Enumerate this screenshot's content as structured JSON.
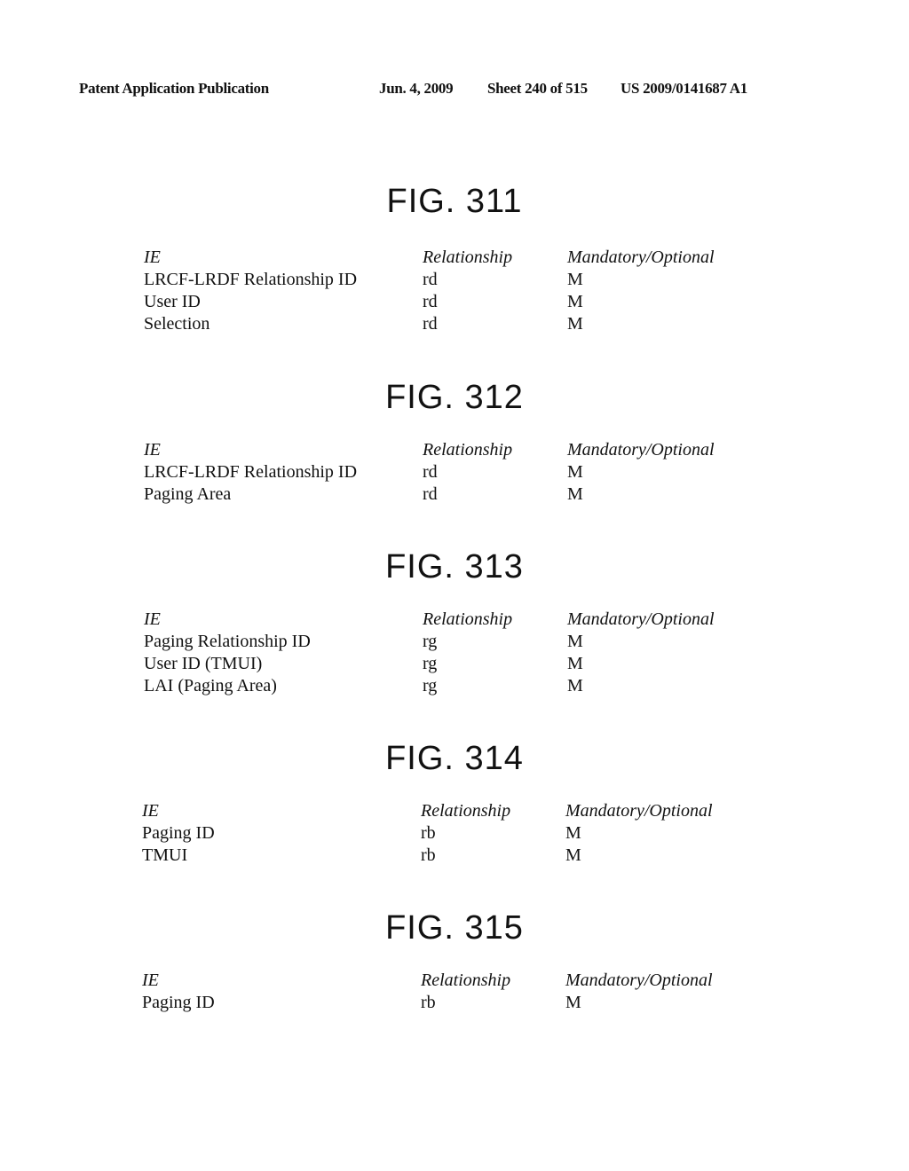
{
  "header": {
    "publication": "Patent Application Publication",
    "date": "Jun. 4, 2009",
    "sheet": "Sheet 240 of 515",
    "number": "US 2009/0141687 A1"
  },
  "figures": [
    {
      "title": "FIG. 311",
      "columns": [
        "IE",
        "Relationship",
        "Mandatory/Optional"
      ],
      "rows": [
        [
          "LRCF-LRDF Relationship ID",
          "rd",
          "M"
        ],
        [
          "User ID",
          "rd",
          "M"
        ],
        [
          "Selection",
          "rd",
          "M"
        ]
      ]
    },
    {
      "title": "FIG. 312",
      "columns": [
        "IE",
        "Relationship",
        "Mandatory/Optional"
      ],
      "rows": [
        [
          "LRCF-LRDF Relationship ID",
          "rd",
          "M"
        ],
        [
          "Paging Area",
          "rd",
          "M"
        ]
      ]
    },
    {
      "title": "FIG. 313",
      "columns": [
        "IE",
        "Relationship",
        "Mandatory/Optional"
      ],
      "rows": [
        [
          "Paging Relationship ID",
          "rg",
          "M"
        ],
        [
          "User ID (TMUI)",
          "rg",
          "M"
        ],
        [
          "LAI (Paging Area)",
          "rg",
          "M"
        ]
      ]
    },
    {
      "title": "FIG. 314",
      "columns": [
        "IE",
        "Relationship",
        "Mandatory/Optional"
      ],
      "rows": [
        [
          "Paging ID",
          "rb",
          "M"
        ],
        [
          "TMUI",
          "rb",
          "M"
        ]
      ]
    },
    {
      "title": "FIG. 315",
      "columns": [
        "IE",
        "Relationship",
        "Mandatory/Optional"
      ],
      "rows": [
        [
          "Paging ID",
          "rb",
          "M"
        ]
      ]
    }
  ]
}
